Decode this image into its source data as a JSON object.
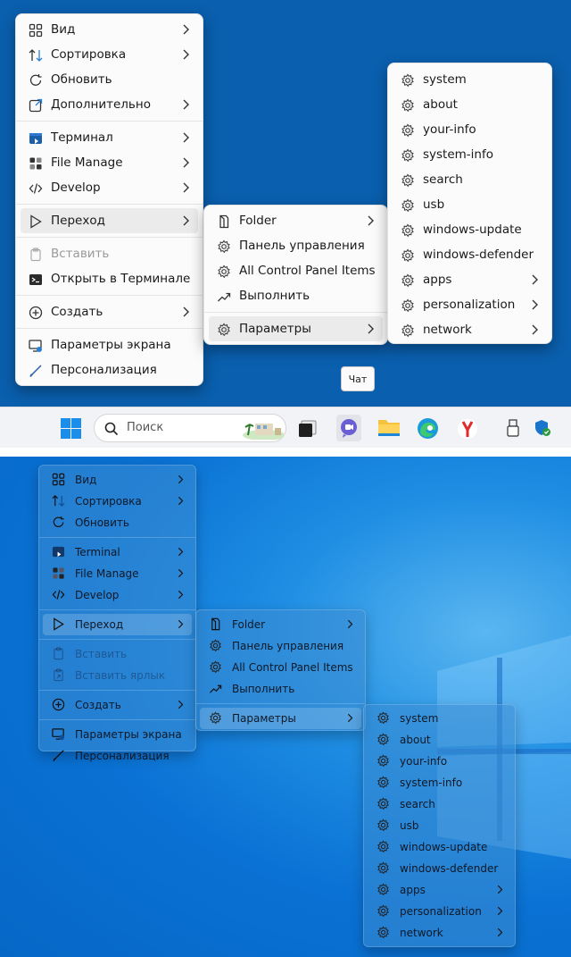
{
  "top": {
    "main_menu": {
      "items": [
        {
          "label": "Вид",
          "icon": "grid-icon",
          "arrow": true
        },
        {
          "label": "Сортировка",
          "icon": "sort-icon",
          "arrow": true
        },
        {
          "label": "Обновить",
          "icon": "refresh-icon",
          "arrow": false
        },
        {
          "label": "Дополнительно",
          "icon": "external-icon",
          "arrow": true
        },
        {
          "label": "Терминал",
          "icon": "terminal-app-icon",
          "arrow": true
        },
        {
          "label": "File Manage",
          "icon": "file-manage-icon",
          "arrow": true
        },
        {
          "label": "Develop",
          "icon": "code-icon",
          "arrow": true
        },
        {
          "label": "Переход",
          "icon": "goto-icon",
          "arrow": true
        },
        {
          "label": "Вставить",
          "icon": "paste-icon",
          "arrow": false
        },
        {
          "label": "Открыть в Терминале",
          "icon": "terminal-icon",
          "arrow": false
        },
        {
          "label": "Создать",
          "icon": "plus-circle-icon",
          "arrow": true
        },
        {
          "label": "Параметры экрана",
          "icon": "display-settings-icon",
          "arrow": false
        },
        {
          "label": "Персонализация",
          "icon": "brush-icon",
          "arrow": false
        }
      ]
    },
    "goto_menu": {
      "items": [
        {
          "label": "Folder",
          "icon": "folder-icon",
          "arrow": true
        },
        {
          "label": "Панель управления",
          "icon": "gear-icon",
          "arrow": false
        },
        {
          "label": "All Control Panel Items",
          "icon": "gear-icon",
          "arrow": false
        },
        {
          "label": "Выполнить",
          "icon": "run-icon",
          "arrow": false
        },
        {
          "label": "Параметры",
          "icon": "gear-icon",
          "arrow": true
        }
      ]
    },
    "settings_menu": {
      "items": [
        {
          "label": "system",
          "arrow": false
        },
        {
          "label": "about",
          "arrow": false
        },
        {
          "label": "your-info",
          "arrow": false
        },
        {
          "label": "system-info",
          "arrow": false
        },
        {
          "label": "search",
          "arrow": false
        },
        {
          "label": "usb",
          "arrow": false
        },
        {
          "label": "windows-update",
          "arrow": false
        },
        {
          "label": "windows-defender",
          "arrow": false
        },
        {
          "label": "apps",
          "arrow": true
        },
        {
          "label": "personalization",
          "arrow": true
        },
        {
          "label": "network",
          "arrow": true
        }
      ]
    },
    "tooltip": "Чат",
    "taskbar": {
      "search_placeholder": "Поиск"
    }
  },
  "bottom": {
    "main_menu": {
      "items": [
        {
          "label": "Вид",
          "icon": "grid-icon",
          "arrow": true
        },
        {
          "label": "Сортировка",
          "icon": "sort-icon",
          "arrow": true
        },
        {
          "label": "Обновить",
          "icon": "refresh-icon",
          "arrow": false
        },
        {
          "label": "Terminal",
          "icon": "terminal-app-icon",
          "arrow": true
        },
        {
          "label": "File Manage",
          "icon": "file-manage-icon",
          "arrow": true
        },
        {
          "label": "Develop",
          "icon": "code-icon",
          "arrow": true
        },
        {
          "label": "Переход",
          "icon": "goto-icon",
          "arrow": true
        },
        {
          "label": "Вставить",
          "icon": "paste-icon",
          "arrow": false
        },
        {
          "label": "Вставить ярлык",
          "icon": "paste-shortcut-icon",
          "arrow": false
        },
        {
          "label": "Создать",
          "icon": "plus-circle-icon",
          "arrow": true
        },
        {
          "label": "Параметры экрана",
          "icon": "display-settings-icon",
          "arrow": false
        },
        {
          "label": "Персонализация",
          "icon": "brush-icon",
          "arrow": false
        }
      ]
    },
    "goto_menu": {
      "items": [
        {
          "label": "Folder",
          "icon": "folder-icon",
          "arrow": true
        },
        {
          "label": "Панель управления",
          "icon": "gear-icon",
          "arrow": false
        },
        {
          "label": "All Control Panel Items",
          "icon": "gear-icon",
          "arrow": false
        },
        {
          "label": "Выполнить",
          "icon": "run-icon",
          "arrow": false
        },
        {
          "label": "Параметры",
          "icon": "gear-icon",
          "arrow": true
        }
      ]
    },
    "settings_menu": {
      "items": [
        {
          "label": "system",
          "arrow": false
        },
        {
          "label": "about",
          "arrow": false
        },
        {
          "label": "your-info",
          "arrow": false
        },
        {
          "label": "system-info",
          "arrow": false
        },
        {
          "label": "search",
          "arrow": false
        },
        {
          "label": "usb",
          "arrow": false
        },
        {
          "label": "windows-update",
          "arrow": false
        },
        {
          "label": "windows-defender",
          "arrow": false
        },
        {
          "label": "apps",
          "arrow": true
        },
        {
          "label": "personalization",
          "arrow": true
        },
        {
          "label": "network",
          "arrow": true
        }
      ]
    }
  },
  "colors": {
    "top_wallpaper": "#0a5fae",
    "bottom_wallpaper": "#0a72d4",
    "menu_light_bg": "#fbfbfb",
    "menu_dark_bg": "#3c8cd2",
    "taskbar_bg": "#f1f3f7"
  }
}
